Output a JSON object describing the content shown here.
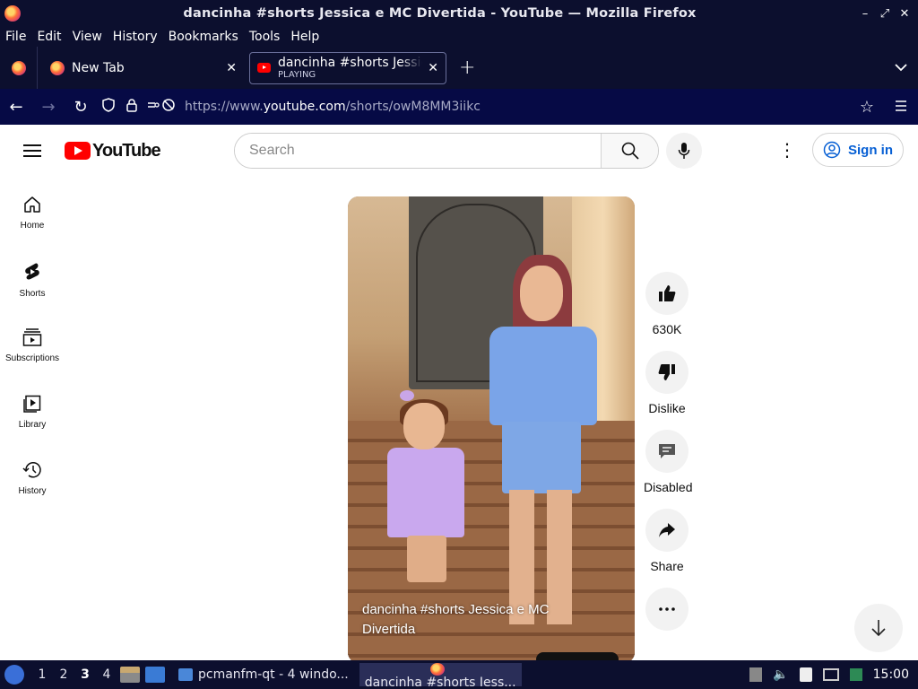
{
  "window": {
    "title": "dancinha #shorts Jessica e MC Divertida - YouTube — Mozilla Firefox",
    "controls": [
      "–",
      "⤢",
      "✕"
    ]
  },
  "menu": [
    "File",
    "Edit",
    "View",
    "History",
    "Bookmarks",
    "Tools",
    "Help"
  ],
  "tabs": [
    {
      "label": "New Tab",
      "icon": "firefox-icon"
    },
    {
      "label": "dancinha #shorts Jessica e MC Divertida",
      "sub": "PLAYING",
      "icon": "youtube-icon"
    }
  ],
  "nav": {
    "url_prefix": "https://www.",
    "url_domain": "youtube.com",
    "url_path": "/shorts/owM8MM3iikc"
  },
  "youtube": {
    "logo_text": "YouTube",
    "search_placeholder": "Search",
    "signin_label": "Sign in"
  },
  "sidebar": [
    {
      "label": "Home",
      "icon": "home-icon"
    },
    {
      "label": "Shorts",
      "icon": "shorts-icon"
    },
    {
      "label": "Subscriptions",
      "icon": "subscriptions-icon"
    },
    {
      "label": "Library",
      "icon": "library-icon"
    },
    {
      "label": "History",
      "icon": "history-icon"
    }
  ],
  "video": {
    "title": "dancinha #shorts Jessica e MC Divertida"
  },
  "actions": [
    {
      "label": "630K",
      "icon": "like-icon"
    },
    {
      "label": "Dislike",
      "icon": "dislike-icon"
    },
    {
      "label": "Disabled",
      "icon": "comments-icon"
    },
    {
      "label": "Share",
      "icon": "share-icon"
    },
    {
      "label": "",
      "icon": "more-icon"
    }
  ],
  "taskbar": {
    "workspaces": [
      "1",
      "2",
      "3",
      "4"
    ],
    "current_workspace": "3",
    "windows": [
      {
        "label": "pcmanfm-qt - 4 windo...",
        "icon": "folder-icon"
      },
      {
        "label": "dancinha #shorts Jess...",
        "icon": "firefox-icon"
      }
    ],
    "clock": "15:00"
  },
  "colors": {
    "chrome_dark": "#0c0f2e",
    "toolbar": "#060a45",
    "youtube_red": "#ff0000",
    "link_blue": "#065fd4"
  }
}
